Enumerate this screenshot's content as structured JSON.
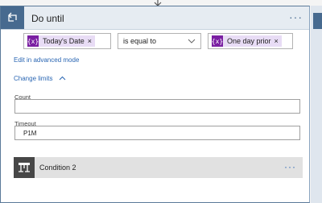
{
  "header": {
    "title": "Do until",
    "more_label": "···",
    "icon": "do-until-loop-icon"
  },
  "condition": {
    "left_token": {
      "label": "Today's Date",
      "icon": "{x}",
      "remove": "×"
    },
    "operator": "is equal to",
    "right_token": {
      "label": "One day prior",
      "icon": "{x}",
      "remove": "×"
    }
  },
  "links": {
    "advanced_mode": "Edit in advanced mode",
    "change_limits": "Change limits"
  },
  "fields": {
    "count_label": "Count",
    "count_value": "",
    "timeout_label": "Timeout",
    "timeout_value": "P1M"
  },
  "condition_card": {
    "title": "Condition 2",
    "more_label": "···",
    "icon": "condition-icon"
  },
  "colors": {
    "accent": "#476a8f",
    "token_bg": "#e8dcf5",
    "token_icon": "#7a1fa2",
    "link": "#2a66b3"
  }
}
